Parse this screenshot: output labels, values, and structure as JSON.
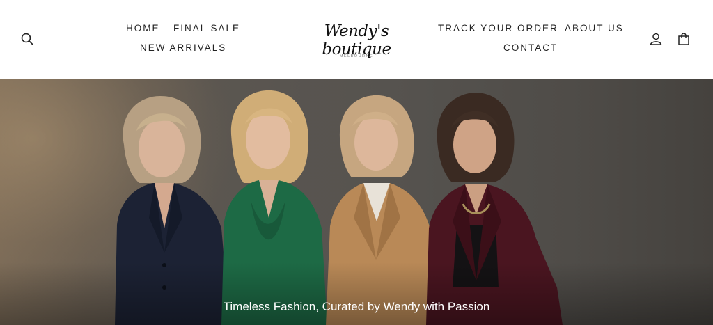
{
  "header": {
    "nav_left": [
      "HOME",
      "FINAL SALE",
      "NEW ARRIVALS"
    ],
    "nav_right": [
      "TRACK YOUR ORDER",
      "ABOUT US",
      "CONTACT"
    ],
    "logo": {
      "script": "Wendy's boutique",
      "subtitle": "MELBOURNE"
    },
    "icons": [
      "search-icon",
      "account-icon",
      "cart-icon"
    ]
  },
  "hero": {
    "caption": "Timeless Fashion, Curated by Wendy with Passion",
    "colors": {
      "navy_blazer": "#1b2233",
      "green_dress": "#1d6a45",
      "camel_blazer": "#b98957",
      "burgundy_blazer": "#4a1520"
    }
  }
}
